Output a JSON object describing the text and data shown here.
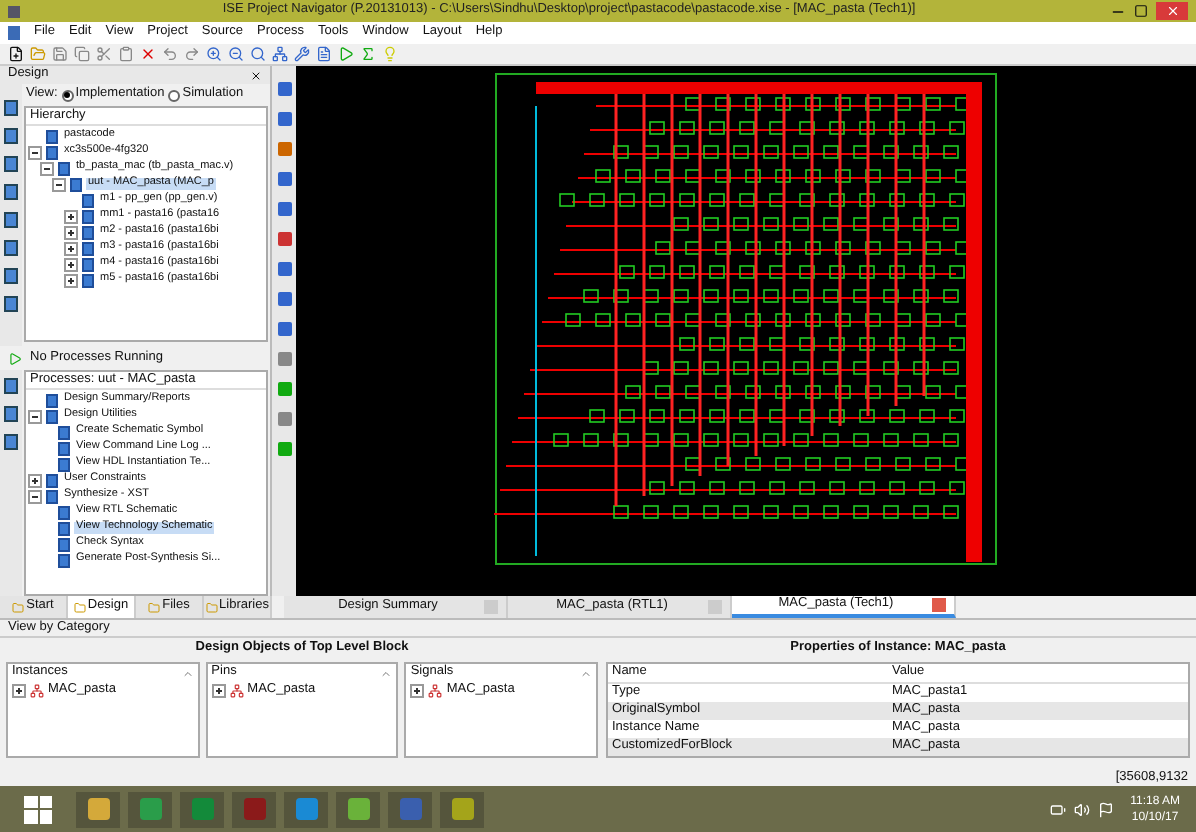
{
  "window": {
    "title": "ISE Project Navigator (P.20131013) - C:\\Users\\Sindhu\\Desktop\\project\\pastacode\\pastacode.xise - [MAC_pasta (Tech1)]"
  },
  "menu": [
    "File",
    "Edit",
    "View",
    "Project",
    "Source",
    "Process",
    "Tools",
    "Window",
    "Layout",
    "Help"
  ],
  "design_panel": {
    "title": "Design",
    "view_label": "View:",
    "view_options": [
      {
        "label": "Implementation",
        "selected": true
      },
      {
        "label": "Simulation",
        "selected": false
      }
    ],
    "hierarchy_title": "Hierarchy",
    "hierarchy": [
      {
        "label": "pastacode",
        "selected": false
      },
      {
        "label": "xc3s500e-4fg320",
        "expanded": true,
        "selected": false,
        "children": [
          {
            "label": "tb_pasta_mac (tb_pasta_mac.v)",
            "expanded": true,
            "selected": false,
            "children": [
              {
                "label": "uut - MAC_pasta (MAC_p",
                "expanded": true,
                "selected": true,
                "children": [
                  {
                    "label": "m1 - pp_gen (pp_gen.v)",
                    "selected": false
                  },
                  {
                    "label": "mm1 - pasta16 (pasta16",
                    "expanded": false,
                    "selected": false
                  },
                  {
                    "label": "m2 - pasta16 (pasta16bi",
                    "expanded": false,
                    "selected": false
                  },
                  {
                    "label": "m3 - pasta16 (pasta16bi",
                    "expanded": false,
                    "selected": false
                  },
                  {
                    "label": "m4 - pasta16 (pasta16bi",
                    "expanded": false,
                    "selected": false
                  },
                  {
                    "label": "m5 - pasta16 (pasta16bi",
                    "expanded": false,
                    "selected": false
                  }
                ]
              }
            ]
          }
        ]
      }
    ],
    "process_status": "No Processes Running",
    "processes_title": "Processes: uut - MAC_pasta",
    "processes": [
      {
        "label": "Design Summary/Reports",
        "selected": false
      },
      {
        "label": "Design Utilities",
        "expanded": true,
        "selected": false,
        "children": [
          {
            "label": "Create Schematic Symbol",
            "selected": false
          },
          {
            "label": "View Command Line Log ...",
            "selected": false
          },
          {
            "label": "View HDL Instantiation Te...",
            "selected": false
          }
        ]
      },
      {
        "label": "User Constraints",
        "expanded": false,
        "selected": false
      },
      {
        "label": "Synthesize - XST",
        "expanded": true,
        "selected": false,
        "children": [
          {
            "label": "View RTL Schematic",
            "selected": false
          },
          {
            "label": "View Technology Schematic",
            "selected": true
          },
          {
            "label": "Check Syntax",
            "selected": false
          },
          {
            "label": "Generate Post-Synthesis Si...",
            "selected": false
          }
        ]
      }
    ],
    "tabs": [
      {
        "label": "Start",
        "selected": false
      },
      {
        "label": "Design",
        "selected": true
      },
      {
        "label": "Files",
        "selected": false
      },
      {
        "label": "Libraries",
        "selected": false
      }
    ]
  },
  "document_tabs": [
    {
      "label": "Design Summary",
      "selected": false
    },
    {
      "label": "MAC_pasta (RTL1)",
      "selected": false
    },
    {
      "label": "MAC_pasta (Tech1)",
      "selected": true
    }
  ],
  "view_by": "View by Category",
  "objects": {
    "title": "Design Objects of Top Level Block",
    "lists": [
      {
        "title": "Instances",
        "items": [
          "MAC_pasta"
        ]
      },
      {
        "title": "Pins",
        "items": [
          "MAC_pasta"
        ]
      },
      {
        "title": "Signals",
        "items": [
          "MAC_pasta"
        ]
      }
    ]
  },
  "properties": {
    "title": "Properties of Instance: MAC_pasta",
    "columns": [
      "Name",
      "Value"
    ],
    "rows": [
      [
        "Type",
        "MAC_pasta1"
      ],
      [
        "OriginalSymbol",
        "MAC_pasta"
      ],
      [
        "Instance Name",
        "MAC_pasta"
      ],
      [
        "CustomizedForBlock",
        "MAC_pasta"
      ]
    ]
  },
  "status_bar": "[35608,9132",
  "taskbar": {
    "time": "11:18 AM",
    "date": "10/10/17"
  }
}
